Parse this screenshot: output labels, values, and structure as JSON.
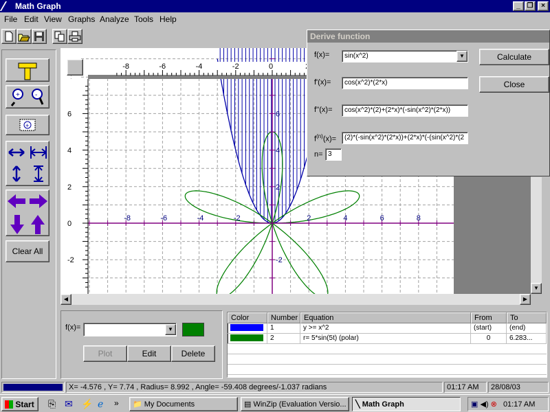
{
  "window": {
    "title": "Math Graph",
    "min_label": "_",
    "max_label": "❐",
    "close_label": "×"
  },
  "menu": [
    "File",
    "Edit",
    "View",
    "Graphs",
    "Analyze",
    "Tools",
    "Help"
  ],
  "toolbar": [
    "new-icon",
    "open-icon",
    "save-icon",
    "copy-icon",
    "print-icon"
  ],
  "sidebar": {
    "clear_all_label": "Clear All"
  },
  "graph": {
    "x_ticks": [
      "-8",
      "-6",
      "-4",
      "-2",
      "0",
      "2",
      "4",
      "6",
      "8"
    ],
    "y_ticks": [
      "6",
      "4",
      "2",
      "0",
      "-2"
    ],
    "inner_x_ticks": [
      "-8",
      "-6",
      "-4",
      "-2",
      "2",
      "4",
      "6",
      "8"
    ],
    "inner_y_ticks": [
      "6",
      "4",
      "2",
      "-2"
    ],
    "curve1_color": "#0000a8",
    "curve2_color": "#008000"
  },
  "dialog": {
    "title": "Derive function",
    "f_label": "f(x)=",
    "f_value": "sin(x^2)",
    "d1_label": "f'(x)=",
    "d1_value": "cos(x^2)*(2*x)",
    "d2_label": "f''(x)=",
    "d2_value": "cos(x^2)*(2)+(2*x)*(-sin(x^2)*(2*x))",
    "dn_label_pre": "f",
    "dn_label_sup": "(n)",
    "dn_label_post": "(x)=",
    "dn_value": "(2)*(-sin(x^2)*(2*x))+(2*x)*(-(sin(x^2)*(2",
    "n_label": "n=",
    "n_value": "3",
    "calculate_label": "Calculate",
    "close_label": "Close"
  },
  "entry": {
    "f_label": "f(x)=",
    "f_value": "",
    "color": "#008000",
    "plot_label": "Plot",
    "edit_label": "Edit",
    "delete_label": "Delete"
  },
  "table": {
    "headers": [
      "Color",
      "Number",
      "Equation",
      "From",
      "To"
    ],
    "rows": [
      {
        "color": "#0000ff",
        "number": "1",
        "equation": "y >= x^2",
        "from": "(start)",
        "to": "(end)"
      },
      {
        "color": "#008000",
        "number": "2",
        "equation": "r= 5*sin(5t) (polar)",
        "from": "0",
        "to": "6.283..."
      }
    ]
  },
  "status": {
    "coords": "X= -4.576 , Y= 7.74 , Radius= 8.992 , Angle= -59.408 degrees/-1.037 radians",
    "time": "01:17 AM",
    "date": "28/08/03"
  },
  "taskbar": {
    "start_label": "Start",
    "more_label": "»",
    "tasks": [
      "My Documents",
      "WinZip (Evaluation Versio...",
      "Math Graph"
    ],
    "clock": "01:17 AM"
  }
}
